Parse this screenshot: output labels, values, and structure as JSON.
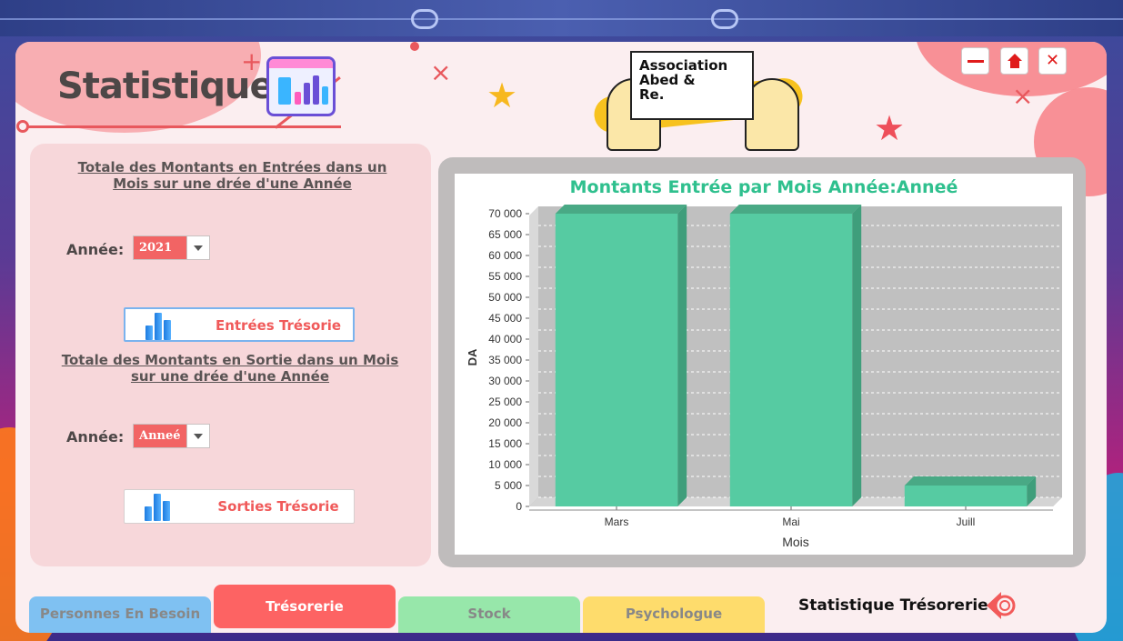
{
  "page": {
    "title": "Statistique",
    "logo_text": [
      "Association",
      "Abed &",
      "Re."
    ]
  },
  "window_controls": {
    "minimize": "minimize-icon",
    "home": "home-icon",
    "close": "close-icon"
  },
  "colors": {
    "accent": "#f26464",
    "chart_bar": "#56cba2",
    "chart_title": "#2fc08e",
    "tab_personnes": "#7fc1f2",
    "tab_tresorerie": "#fd6363",
    "tab_stock": "#97e7aa",
    "tab_psychologue": "#fedc6c"
  },
  "entrees": {
    "title_line1": "Totale des Montants en Entrées dans un",
    "title_line2": "Mois sur une drée d'une Année",
    "year_label": "Année:",
    "year_value": "2021",
    "button_label": "Entrées Trésorie"
  },
  "sorties": {
    "title_line1": "Totale des Montants en Sortie dans un Mois",
    "title_line2": "sur une drée d'une Année",
    "year_label": "Année:",
    "year_value": "Anneé",
    "button_label": "Sorties Trésorie"
  },
  "chart_data": {
    "type": "bar",
    "title": "Montants Entrée par Mois   Année:Anneé",
    "xlabel": "Mois",
    "ylabel": "DA",
    "categories": [
      "Mars",
      "Mai",
      "Juill"
    ],
    "values": [
      70000,
      70000,
      5000
    ],
    "ylim": [
      0,
      70000
    ],
    "yticks": [
      "0",
      "5 000",
      "10 000",
      "15 000",
      "20 000",
      "25 000",
      "30 000",
      "35 000",
      "40 000",
      "45 000",
      "50 000",
      "55 000",
      "60 000",
      "65 000",
      "70 000"
    ],
    "grid": true,
    "legend": "none"
  },
  "tabs": [
    {
      "label": "Personnes En Besoin",
      "color": "#7fc1f2",
      "active": false
    },
    {
      "label": "Trésorerie",
      "color": "#fd6363",
      "active": true
    },
    {
      "label": "Stock",
      "color": "#97e7aa",
      "active": false
    },
    {
      "label": "Psychologue",
      "color": "#fedc6c",
      "active": false
    }
  ],
  "footer": {
    "section_title": "Statistique Trésorerie",
    "back_icon": "back-arrow-icon"
  }
}
